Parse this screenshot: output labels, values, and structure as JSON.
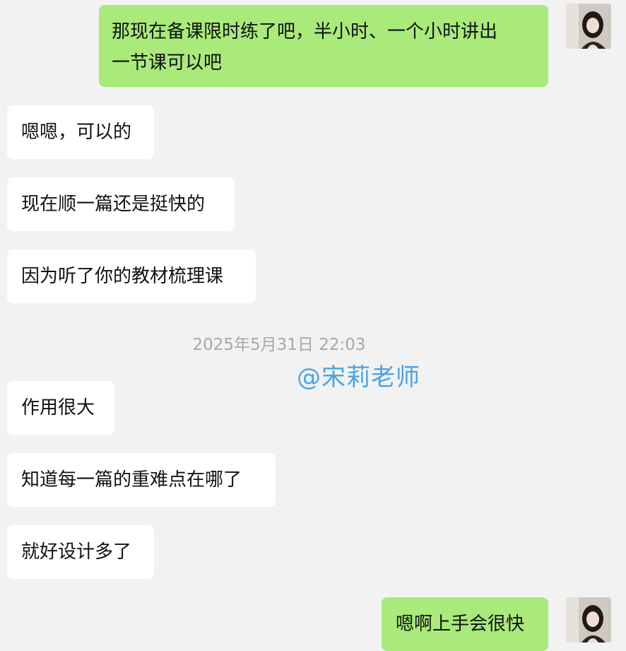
{
  "messages": {
    "m1": "那现在备课限时练了吧，半小时、一个小时讲出",
    "m1b": "一节课可以吧",
    "m2": "嗯嗯，可以的",
    "m3": "现在顺一篇还是挺快的",
    "m4": "因为听了你的教材梳理课",
    "m5": "作用很大",
    "m6": "知道每一篇的重难点在哪了",
    "m7": "就好设计多了",
    "m8": "嗯啊上手会很快"
  },
  "timestamp": "2025年5月31日 22:03",
  "watermark": "@宋莉老师",
  "colors": {
    "background": "#f2f2f2",
    "incoming_bubble": "#ffffff",
    "outgoing_bubble": "#a9ea7a",
    "timestamp_text": "#a8a8a8",
    "watermark_text": "#4aa3e8"
  }
}
